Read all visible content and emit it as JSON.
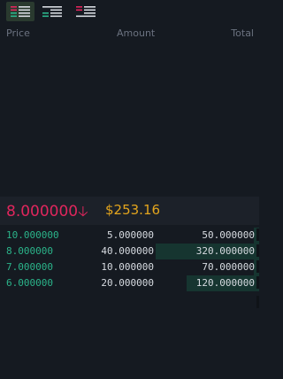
{
  "toolbar": {
    "buttons": [
      {
        "name": "both-sides-view-button",
        "icon": "orderbook-both-icon",
        "active": true
      },
      {
        "name": "bids-only-view-button",
        "icon": "orderbook-bids-icon",
        "active": false
      },
      {
        "name": "asks-only-view-button",
        "icon": "orderbook-asks-icon",
        "active": false
      }
    ]
  },
  "columns": {
    "price": "Price",
    "amount": "Amount",
    "total": "Total"
  },
  "ticker": {
    "last_price": "8.000000",
    "direction_icon": "arrow-down-icon",
    "usd_price": "$253.16"
  },
  "bids": [
    {
      "price": "10.000000",
      "amount": "5.000000",
      "total": "50.000000",
      "depth": 0.02
    },
    {
      "price": "8.000000",
      "amount": "40.000000",
      "total": "320.000000",
      "depth": 0.4
    },
    {
      "price": "7.000000",
      "amount": "10.000000",
      "total": "70.000000",
      "depth": 0.02
    },
    {
      "price": "6.000000",
      "amount": "20.000000",
      "total": "120.000000",
      "depth": 0.28
    }
  ],
  "colors": {
    "bid": "#2bb48a",
    "ask": "#e0265d",
    "usd": "#e3a51d",
    "background": "#151a21"
  }
}
